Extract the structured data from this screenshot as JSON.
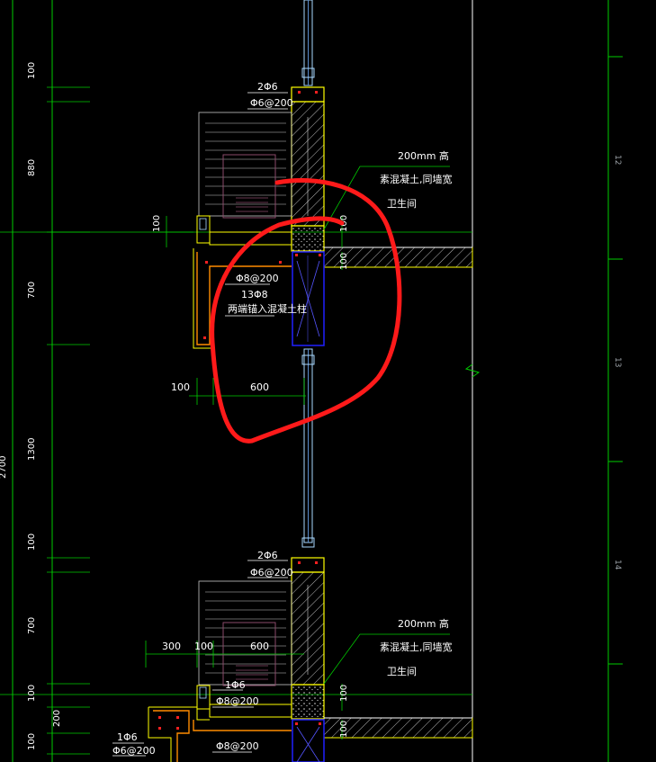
{
  "left_dims": [
    "100",
    "880",
    "700",
    "1300",
    "2700",
    "100",
    "700",
    "100",
    "200",
    "100"
  ],
  "right_marks": [
    "12",
    "13",
    "14"
  ],
  "upper": {
    "top_rebar": "2Φ6",
    "top_stirrup": "Φ6@200",
    "dim_100_left": "100",
    "dim_100_wall_a": "100",
    "dim_100_wall_b": "100",
    "beam_rebar_a": "Φ8@200",
    "beam_rebar_b": "13Φ8",
    "beam_note": "两端锚入混凝土柱",
    "dim_bottom_100": "100",
    "dim_bottom_600": "600",
    "note_line1": "200mm   高",
    "note_line2": "素混凝土,同墙宽",
    "note_line3": "卫生间"
  },
  "lower": {
    "top_rebar": "2Φ6",
    "top_stirrup": "Φ6@200",
    "dim_300": "300",
    "dim_100": "100",
    "dim_600": "600",
    "rebar_a": "1Φ6",
    "rebar_b": "Φ8@200",
    "rebar_c": "1Φ6",
    "rebar_d": "Φ6@200",
    "rebar_e": "Φ8@200",
    "dim_wall_100": "100",
    "dim_wall_100b": "100",
    "note_line1": "200mm   高",
    "note_line2": "素混凝土,同墙宽",
    "note_line3": "卫生间"
  },
  "colors": {
    "background": "#000000",
    "dimension": "#00ff00",
    "wall": "#ffff00",
    "section": "#ff8c00",
    "window": "#0000ff",
    "pipe": "#a8d8ff",
    "markup": "#ff0000",
    "hatch": "#d0d0d0"
  }
}
